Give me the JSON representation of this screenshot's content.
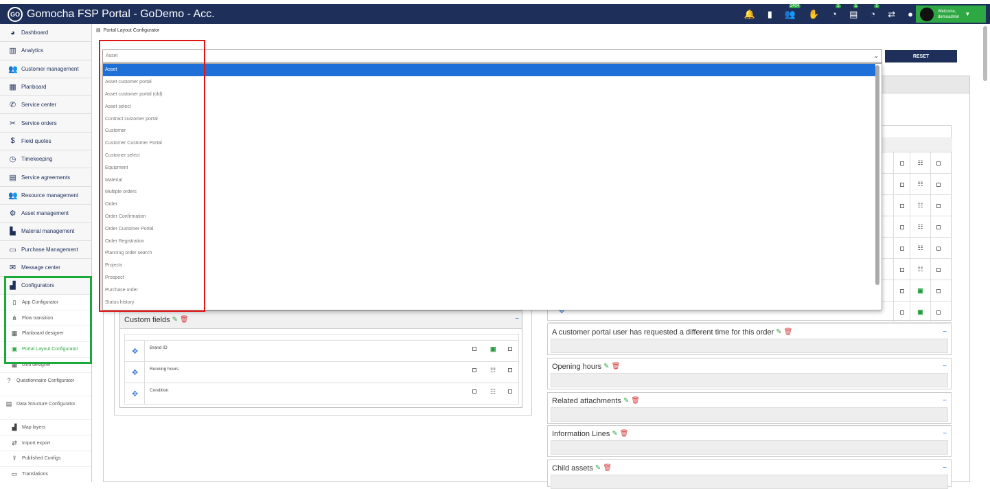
{
  "app": {
    "title": "Gomocha FSP Portal - GoDemo - Acc.",
    "logo_text": "GO"
  },
  "topbar": {
    "icons": [
      {
        "name": "bell-icon",
        "glyph": "🔔",
        "badge": ""
      },
      {
        "name": "document-icon",
        "glyph": "▮",
        "badge": ""
      },
      {
        "name": "people-icon",
        "glyph": "👥",
        "badge": "2404"
      },
      {
        "name": "handshake-icon",
        "glyph": "✋",
        "badge": ""
      },
      {
        "name": "clock-icon",
        "glyph": "◔",
        "badge": "1"
      },
      {
        "name": "chart-icon",
        "glyph": "▤",
        "badge": "1"
      },
      {
        "name": "clock-alt-icon",
        "glyph": "◔",
        "badge": "1"
      },
      {
        "name": "transfer-icon",
        "glyph": "⇄",
        "badge": ""
      },
      {
        "name": "chat-icon",
        "glyph": "●",
        "badge": ""
      }
    ],
    "user": {
      "welcome": "Welcome,",
      "name": "demoadmin"
    },
    "accent": "#2ea843",
    "bar_color": "#1e2f5a"
  },
  "sidebar": {
    "items": [
      {
        "label": "Dashboard",
        "icon": "dashboard-icon",
        "glyph": "◕"
      },
      {
        "label": "Analytics",
        "icon": "analytics-icon",
        "glyph": "▥"
      },
      {
        "label": "Customer management",
        "icon": "customers-icon",
        "glyph": "👥"
      },
      {
        "label": "Planboard",
        "icon": "calendar-icon",
        "glyph": "▦"
      },
      {
        "label": "Service center",
        "icon": "phone-icon",
        "glyph": "✆"
      },
      {
        "label": "Service orders",
        "icon": "tools-icon",
        "glyph": "✂"
      },
      {
        "label": "Field quotes",
        "icon": "quote-icon",
        "glyph": "$"
      },
      {
        "label": "Timekeeping",
        "icon": "clock-icon",
        "glyph": "◷"
      },
      {
        "label": "Service agreements",
        "icon": "agreement-icon",
        "glyph": "▤"
      },
      {
        "label": "Resource management",
        "icon": "resources-icon",
        "glyph": "👥"
      },
      {
        "label": "Asset management",
        "icon": "assets-icon",
        "glyph": "⚙"
      },
      {
        "label": "Material management",
        "icon": "material-icon",
        "glyph": "▙"
      },
      {
        "label": "Purchase Management",
        "icon": "purchase-icon",
        "glyph": "▭"
      },
      {
        "label": "Message center",
        "icon": "envelope-icon",
        "glyph": "✉"
      },
      {
        "label": "Configurators",
        "icon": "factory-icon",
        "glyph": "▟"
      }
    ],
    "subitems": [
      {
        "label": "App Configurator",
        "icon": "mobile-icon",
        "glyph": "▯",
        "active": false,
        "two": false
      },
      {
        "label": "Flow transition",
        "icon": "flow-icon",
        "glyph": "⋔",
        "active": false,
        "two": false
      },
      {
        "label": "Planboard designer",
        "icon": "planboard-designer-icon",
        "glyph": "▦",
        "active": false,
        "two": false
      },
      {
        "label": "Portal Layout Configurator",
        "icon": "layout-icon",
        "glyph": "▣",
        "active": true,
        "two": false
      },
      {
        "label": "Grid designer",
        "icon": "grid-icon",
        "glyph": "▦",
        "active": false,
        "two": false
      },
      {
        "label": "Questionnaire Configurator",
        "icon": "question-icon",
        "glyph": "?",
        "active": false,
        "two": true
      },
      {
        "label": "Data Structure Configurator",
        "icon": "database-icon",
        "glyph": "▤",
        "active": false,
        "two": true
      },
      {
        "label": "Map layers",
        "icon": "map-icon",
        "glyph": "▟",
        "active": false,
        "two": false
      },
      {
        "label": "Import export",
        "icon": "import-export-icon",
        "glyph": "⇄",
        "active": false,
        "two": false
      },
      {
        "label": "Published Configs",
        "icon": "publish-icon",
        "glyph": "⇪",
        "active": false,
        "two": false
      },
      {
        "label": "Translations",
        "icon": "translate-icon",
        "glyph": "▭",
        "active": false,
        "two": false
      }
    ]
  },
  "breadcrumb": {
    "label": "Portal Layout Configurator"
  },
  "selector": {
    "value": "Asset",
    "reset_label": "RESET",
    "options": [
      "Asset",
      "Asset customer portal",
      "Asset customer portal (old)",
      "Asset select",
      "Contract customer portal",
      "Customer",
      "Customer Customer Portal",
      "Customer select",
      "Equipment",
      "Material",
      "Multiple orders",
      "Order",
      "Order Confirmation",
      "Order Customer Portal",
      "Order Registration",
      "Planning order search",
      "Projects",
      "Prospect",
      "Purchase order",
      "Status history"
    ]
  },
  "custom_fields": {
    "title": "Custom fields",
    "rows": [
      {
        "label": "Brand ID",
        "icon": "green"
      },
      {
        "label": "Running hours",
        "icon": "list"
      },
      {
        "label": "Condition",
        "icon": "list"
      }
    ]
  },
  "right_grid": {
    "row_icons": [
      "list",
      "list",
      "list",
      "list",
      "list",
      "list",
      "green",
      "green"
    ]
  },
  "sections": [
    {
      "title": "A customer portal user has requested a different time for this order"
    },
    {
      "title": "Opening hours"
    },
    {
      "title": "Related attachments"
    },
    {
      "title": "Information Lines"
    },
    {
      "title": "Child assets"
    }
  ]
}
